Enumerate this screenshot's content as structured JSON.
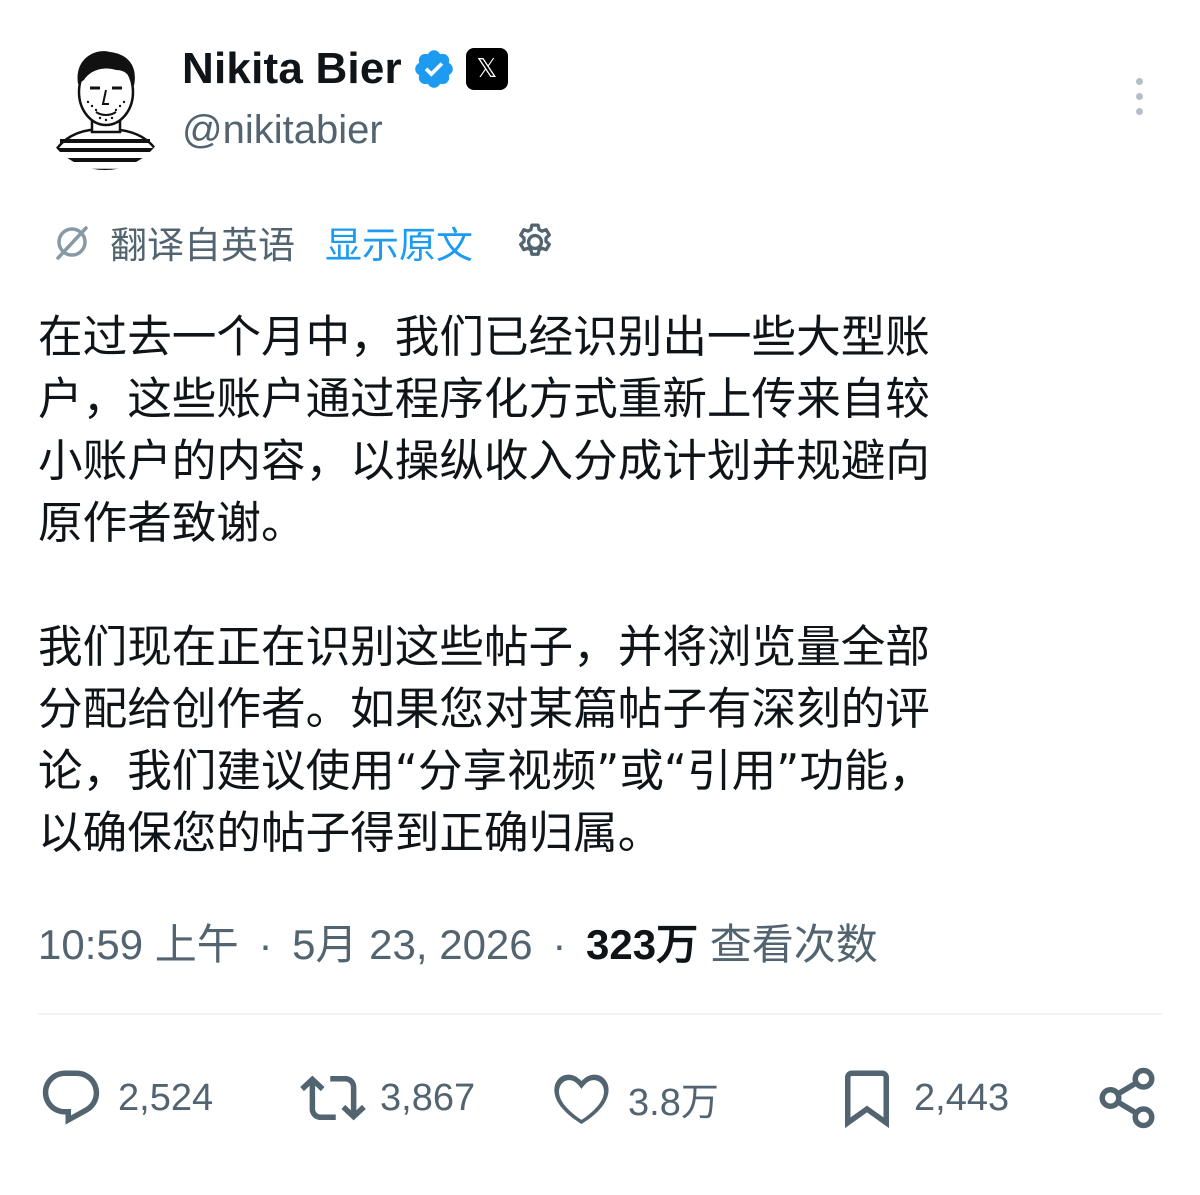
{
  "author": {
    "display_name": "Nikita Bier",
    "handle": "@nikitabier"
  },
  "translation": {
    "label": "翻译自英语",
    "show_original": "显示原文"
  },
  "post": {
    "paragraph_1": "在过去一个月中，我们已经识别出一些大型账\n户，这些账户通过程序化方式重新上传来自较\n小账户的内容，以操纵收入分成计划并规避向\n原作者致谢。",
    "paragraph_2": "我们现在正在识别这些帖子，并将浏览量全部\n分配给创作者。如果您对某篇帖子有深刻的评\n论，我们建议使用“分享视频”或“引用”功能，\n以确保您的帖子得到正确归属。"
  },
  "meta": {
    "time": "10:59 上午",
    "date": "5月 23, 2026",
    "views_count": "323万",
    "views_label": "查看次数"
  },
  "actions": {
    "replies": "2,524",
    "reposts": "3,867",
    "likes": "3.8万",
    "bookmarks": "2,443"
  },
  "icons": [
    "verified-badge-icon",
    "x-affiliate-icon",
    "more-icon",
    "translate-icon",
    "gear-icon",
    "reply-icon",
    "repost-icon",
    "like-icon",
    "bookmark-icon",
    "share-icon"
  ],
  "colors": {
    "text": "#0f1419",
    "secondary": "#536471",
    "accent": "#1d9bf0"
  }
}
